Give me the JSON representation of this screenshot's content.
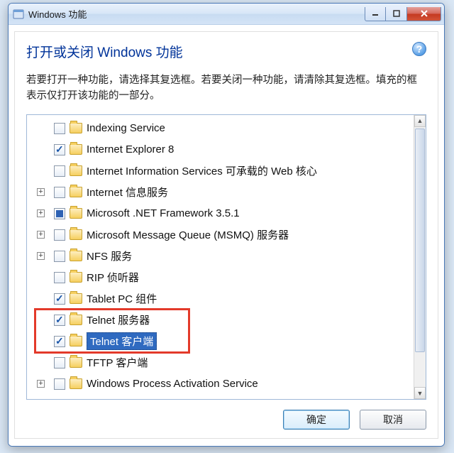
{
  "window": {
    "title": "Windows 功能"
  },
  "dialog": {
    "header": "打开或关闭 Windows 功能",
    "instruction": "若要打开一种功能，请选择其复选框。若要关闭一种功能，请清除其复选框。填充的框表示仅打开该功能的一部分。",
    "help_tooltip": "?"
  },
  "tree": {
    "items": [
      {
        "label": "Indexing Service",
        "state": "unchecked",
        "expandable": false
      },
      {
        "label": "Internet Explorer 8",
        "state": "checked",
        "expandable": false
      },
      {
        "label": "Internet Information Services 可承载的 Web 核心",
        "state": "unchecked",
        "expandable": false
      },
      {
        "label": "Internet 信息服务",
        "state": "unchecked",
        "expandable": true
      },
      {
        "label": "Microsoft .NET Framework 3.5.1",
        "state": "filled",
        "expandable": true
      },
      {
        "label": "Microsoft Message Queue (MSMQ) 服务器",
        "state": "unchecked",
        "expandable": true
      },
      {
        "label": "NFS 服务",
        "state": "unchecked",
        "expandable": true
      },
      {
        "label": "RIP 侦听器",
        "state": "unchecked",
        "expandable": false
      },
      {
        "label": "Tablet PC 组件",
        "state": "checked",
        "expandable": false
      },
      {
        "label": "Telnet 服务器",
        "state": "checked",
        "expandable": false
      },
      {
        "label": "Telnet 客户端",
        "state": "checked",
        "expandable": false,
        "selected": true
      },
      {
        "label": "TFTP 客户端",
        "state": "unchecked",
        "expandable": false
      },
      {
        "label": "Windows Process Activation Service",
        "state": "unchecked",
        "expandable": true
      }
    ]
  },
  "buttons": {
    "ok": "确定",
    "cancel": "取消"
  }
}
